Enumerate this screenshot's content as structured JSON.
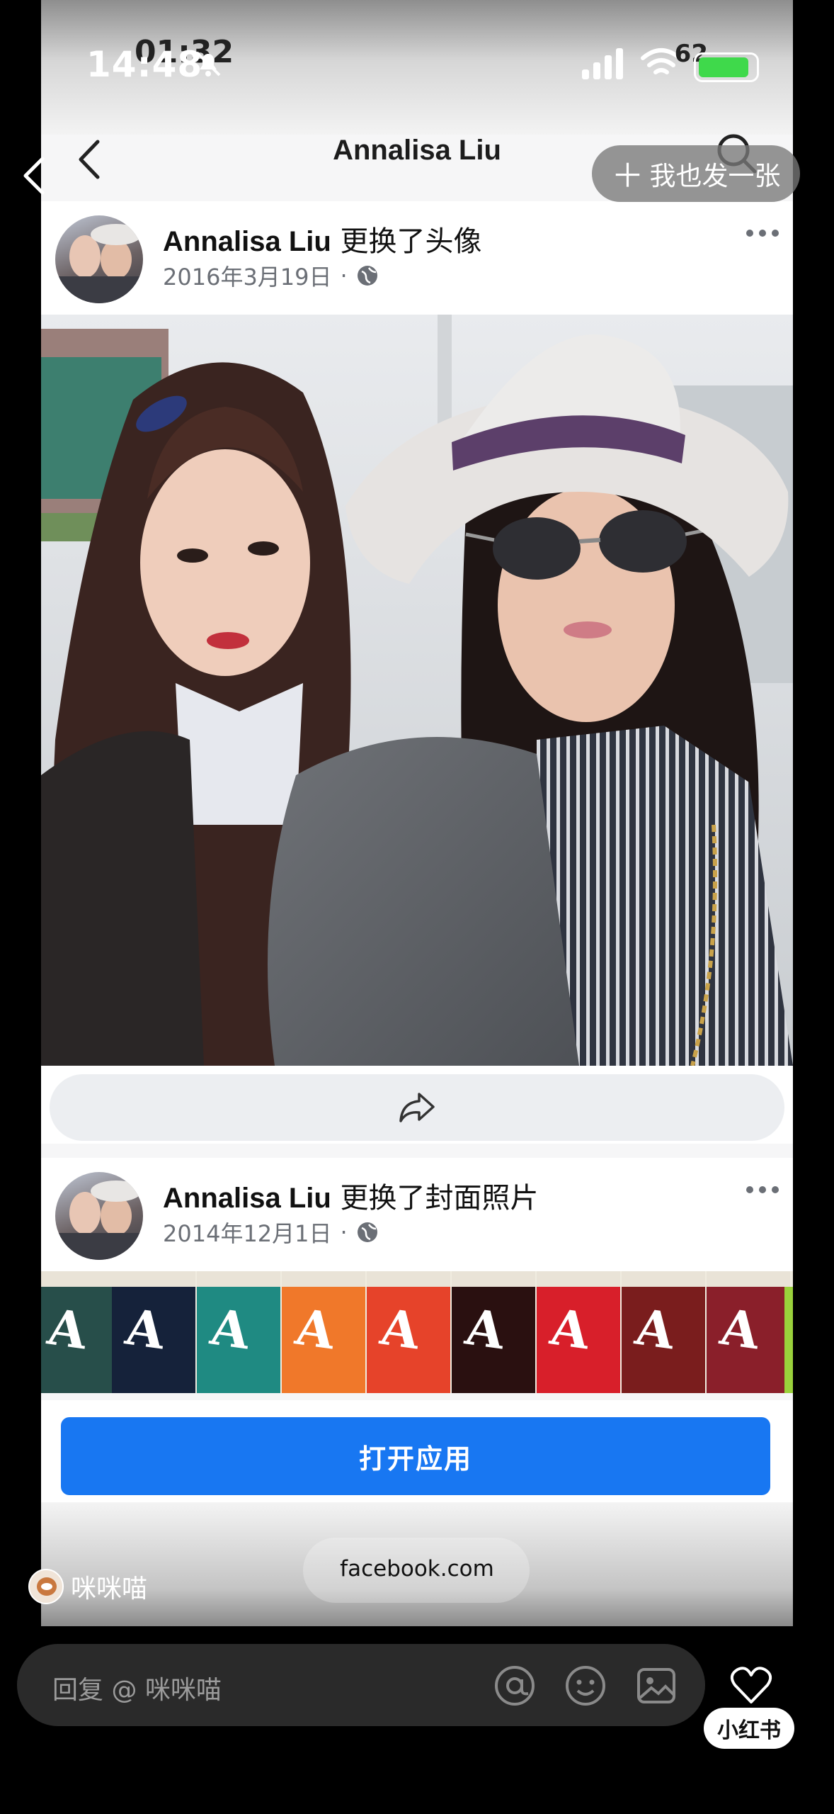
{
  "status_bar": {
    "time_old": "01:32",
    "time": "14:48",
    "battery": "62"
  },
  "nav": {
    "title": "Annalisa Liu"
  },
  "fab": {
    "label": "我也发一张"
  },
  "posts": [
    {
      "author": "Annalisa Liu",
      "action": " 更换了头像",
      "date": "2016年3月19日",
      "separator": "·"
    },
    {
      "author": "Annalisa Liu",
      "action": " 更换了封面照片",
      "date": "2014年12月1日",
      "separator": "·"
    }
  ],
  "open_app": {
    "label": "打开应用"
  },
  "domain": "facebook.com",
  "comment": {
    "username": "咪咪喵"
  },
  "reply": {
    "placeholder": "回复 @ 咪咪喵"
  },
  "brand": {
    "label": "小红书"
  },
  "colors": {
    "facebook_blue": "#1877f2",
    "battery_green": "#3fd94b"
  }
}
